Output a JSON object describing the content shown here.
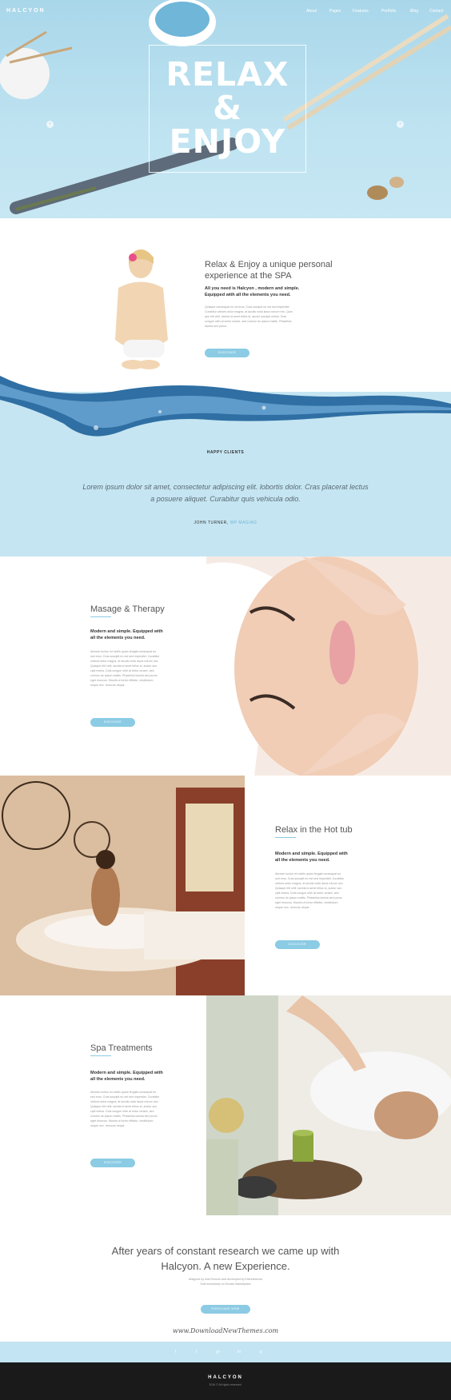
{
  "brand": {
    "logo": "HALCYON",
    "footer_logo": "HALCYON",
    "copyright": "2016 © All rights reserved."
  },
  "nav": [
    "About",
    "Pages",
    "Features",
    "Portfolio",
    "Blog",
    "Contact"
  ],
  "hero": {
    "title_line1": "RELAX",
    "title_line2": "&",
    "title_line3": "ENJOY",
    "prev": "‹",
    "next": "›"
  },
  "intro": {
    "heading_line1": "Relax & Enjoy a unique personal",
    "heading_line2": "experience at the SPA",
    "sub_line1": "All you need is Halcyon , modern and simple.",
    "sub_line2": "Equipped with all the elements you need.",
    "para": [
      "Quisque consequat eu vel eros. Cras suscipit eu est sed imperdiet.",
      "Curabitur ultrices dolor magna, at iaculis nulla lacus rutrum nec. Quis",
      "que elit velit, lacinia id amet tellus id, auctor suscipit metus. Duis",
      "congue nibh at tortor ornare, sed commo do ipsum mattis. Phasellus",
      "lacinia sed purus."
    ],
    "button": "DISCOVER"
  },
  "testimonial": {
    "label": "HAPPY CLIENTS",
    "quote_line1": "Lorem ipsum dolor sit amet, consectetur adipiscing elit. lobortis dolor. Cras placerat lectus",
    "quote_line2": "a posuere aliquet. Curabitur quis vehicula odio.",
    "author": "JOHN TURNER,",
    "company": "WP MAGIAG"
  },
  "sections": [
    {
      "title": "Masage & Therapy",
      "sub_line1": "Modern and simple. Equipped with",
      "sub_line2": "all the elements you need.",
      "para": [
        "Aenean luctus mi mollis quam feugiat consequat eu",
        "sed eros. Cras suscipit eu est sed imperdiet. Curabitur",
        "ultrices dolor magna, at iaculis nulla lacus rutrum nec.",
        "Quisque elit velit, lacinia id amet tellus id, auctor sus",
        "cipit metus. Duis congue nibh at tortor ornare, sed",
        "commo do ipsum mattis. Phasellus lacinia sed purus",
        "eget rhoncus. Mauris ut tortor efficitur, vestibulum",
        "neque nec, rhoncus neque."
      ],
      "button": "DISCOVER"
    },
    {
      "title": "Relax in the Hot tub",
      "sub_line1": "Modern and simple. Equipped with",
      "sub_line2": "all the elements you need.",
      "para": [
        "Aenean luctus mi mollis quam feugiat consequat eu",
        "sed eros. Cras suscipit eu est sed imperdiet. Curabitur",
        "ultrices dolor magna, at iaculis nulla lacus rutrum nec.",
        "Quisque elit velit, lacinia id amet tellus id, auctor sus",
        "cipit metus. Duis congue nibh at tortor ornare, sed",
        "commo do ipsum mattis. Phasellus lacinia sed purus",
        "eget rhoncus. Mauris ut tortor efficitur, vestibulum",
        "neque nec, rhoncus neque."
      ],
      "button": "DISCOVER"
    },
    {
      "title": "Spa Treatments",
      "sub_line1": "Modern and simple. Equipped with",
      "sub_line2": "all the elements you need.",
      "para": [
        "Aenean luctus mi mollis quam feugiat consequat eu",
        "sed eros. Cras suscipit eu est sed imperdiet. Curabitur",
        "ultrices dolor magna, at iaculis nulla lacus rutrum nec.",
        "Quisque elit velit, lacinia id amet tellus id, auctor sus",
        "cipit metus. Duis congue nibh at tortor ornare, sed",
        "commo do ipsum mattis. Phasellus lacinia sed purus",
        "eget rhoncus. Mauris ut tortor efficitur, vestibulum",
        "neque nec, rhoncus neque."
      ],
      "button": "DISCOVER"
    }
  ],
  "closing": {
    "line1": "After years of constant research we came up with",
    "line2": "Halcyon. A new Experience.",
    "credit_line1": "designed by IndoThemes and developed by Elemnthemes",
    "credit_line2": "Sold exclusively on Envato Marketplace",
    "button": "PURCHASE NOW",
    "watermark": "www.DownloadNewThemes.com"
  },
  "social": [
    "f",
    "t",
    "g+",
    "in",
    "p"
  ],
  "colors": {
    "accent": "#8ccbe4",
    "hero_bg": "#bfe3f1",
    "footer_bg": "#1a1a1a"
  }
}
